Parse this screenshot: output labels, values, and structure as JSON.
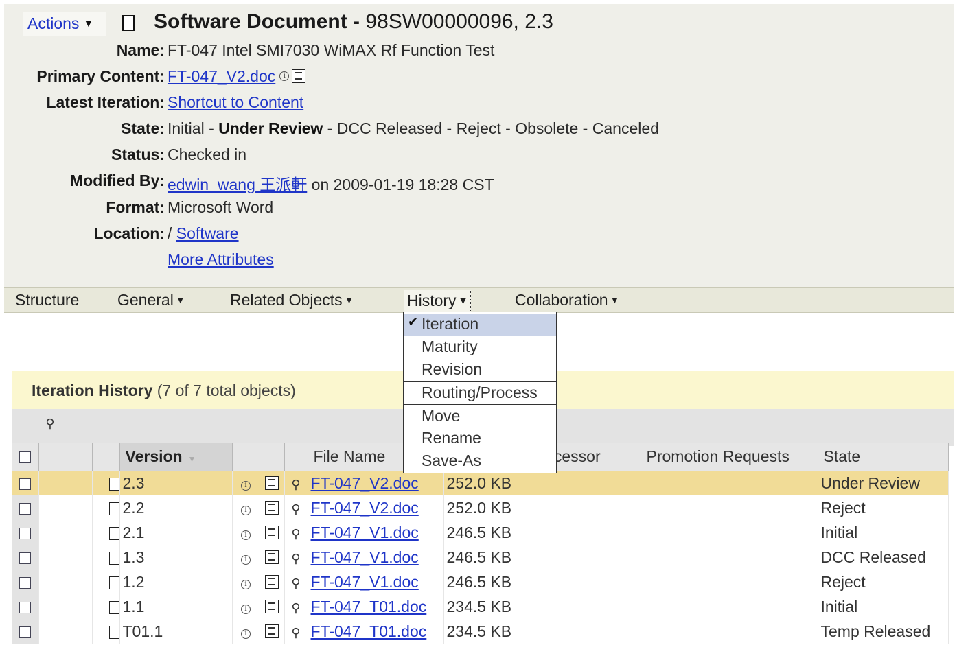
{
  "header": {
    "actions_label": "Actions",
    "title": "Software Document",
    "number": "98SW00000096, 2.3"
  },
  "attributes": {
    "name_label": "Name:",
    "name_value": "FT-047 Intel SMI7030 WiMAX Rf Function Test",
    "primary_content_label": "Primary Content:",
    "primary_content_value": "FT-047_V2.doc",
    "latest_iteration_label": "Latest Iteration:",
    "latest_iteration_value": "Shortcut to Content",
    "state_label": "State:",
    "state_states": [
      "Initial",
      "Under Review",
      "DCC Released",
      "Reject",
      "Obsolete",
      "Canceled"
    ],
    "state_sep": " - ",
    "status_label": "Status:",
    "status_value": "Checked in",
    "modified_by_label": "Modified By:",
    "modified_by_user": "edwin_wang 王派軒",
    "modified_by_date": "on 2009-01-19 18:28 CST",
    "format_label": "Format:",
    "format_value": "Microsoft Word",
    "location_label": "Location:",
    "location_prefix": "/",
    "location_value": "Software",
    "more_attributes": "More Attributes"
  },
  "tabs": [
    {
      "label": "Structure",
      "dropdown": false
    },
    {
      "label": "General",
      "dropdown": true
    },
    {
      "label": "Related Objects",
      "dropdown": true
    },
    {
      "label": "History",
      "dropdown": true,
      "active": true
    },
    {
      "label": "Collaboration",
      "dropdown": true
    }
  ],
  "history_menu": {
    "items": [
      "Iteration",
      "Maturity",
      "Revision",
      "Routing/Process",
      "Move",
      "Rename",
      "Save-As"
    ],
    "checked": "Iteration"
  },
  "panel": {
    "title": "Iteration History",
    "count_text": "(7 of 7 total objects)"
  },
  "table": {
    "columns": [
      "Version",
      "File Name",
      "Predecessor",
      "Promotion Requests",
      "State"
    ],
    "visible_predecessor_fragment": "edecessor",
    "rows": [
      {
        "version": "2.3",
        "file": "FT-047_V2.doc",
        "size": "252.0 KB",
        "state": "Under Review",
        "selected": true
      },
      {
        "version": "2.2",
        "file": "FT-047_V2.doc",
        "size": "252.0 KB",
        "state": "Reject"
      },
      {
        "version": "2.1",
        "file": "FT-047_V1.doc",
        "size": "246.5 KB",
        "state": "Initial"
      },
      {
        "version": "1.3",
        "file": "FT-047_V1.doc",
        "size": "246.5 KB",
        "state": "DCC Released"
      },
      {
        "version": "1.2",
        "file": "FT-047_V1.doc",
        "size": "246.5 KB",
        "state": "Reject"
      },
      {
        "version": "1.1",
        "file": "FT-047_T01.doc",
        "size": "234.5 KB",
        "state": "Initial"
      },
      {
        "version": "T01.1",
        "file": "FT-047_T01.doc",
        "size": "234.5 KB",
        "state": "Temp Released"
      }
    ]
  },
  "colors": {
    "link": "#1f35c8",
    "header_bg": "#efefe9",
    "panel_header_bg": "#fbf7cf",
    "selected_row": "#f1dc97",
    "menu_checked": "#c9d3e8"
  }
}
